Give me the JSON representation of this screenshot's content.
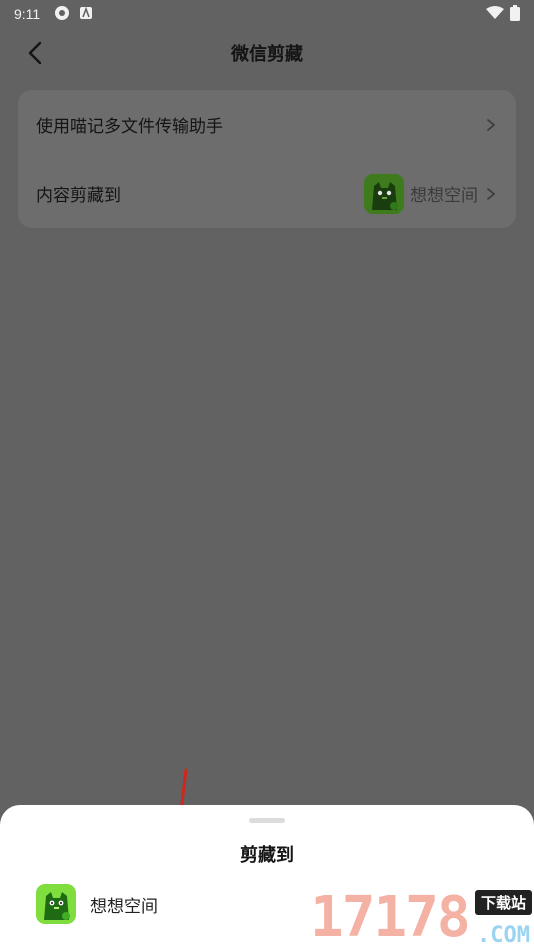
{
  "status_bar": {
    "time": "9:11",
    "left_icons": [
      "radar-icon",
      "a-badge-icon"
    ],
    "right_icons": [
      "wifi-icon",
      "battery-icon"
    ]
  },
  "nav": {
    "back_icon": "chevron-left-icon",
    "title": "微信剪藏"
  },
  "settings": {
    "rows": [
      {
        "label": "使用喵记多文件传输助手",
        "value": ""
      },
      {
        "label": "内容剪藏到",
        "value": "想想空间",
        "icon": "cat-space-icon"
      }
    ]
  },
  "bottom_sheet": {
    "title": "剪藏到",
    "items": [
      {
        "label": "想想空间",
        "icon": "cat-space-icon"
      }
    ]
  },
  "watermark": {
    "numbers": "17178",
    "tag": "下载站",
    "domain": ".COM"
  },
  "colors": {
    "overlay": "#626262",
    "sheet": "#ffffff",
    "app_green": "#7fde3d",
    "arrow_red": "#d0271d"
  }
}
